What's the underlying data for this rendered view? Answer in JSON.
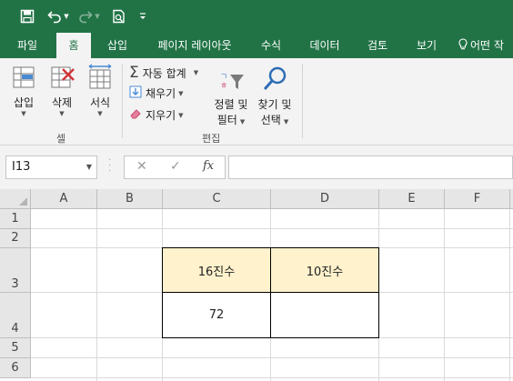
{
  "qat": {
    "save_icon": "save-icon",
    "undo_icon": "undo-icon",
    "redo_icon": "redo-icon",
    "print_preview_icon": "print-preview-icon",
    "customize_icon": "customize-qat-icon"
  },
  "tabs": [
    {
      "label": "파일"
    },
    {
      "label": "홈"
    },
    {
      "label": "삽입"
    },
    {
      "label": "페이지 레이아웃"
    },
    {
      "label": "수식"
    },
    {
      "label": "데이터"
    },
    {
      "label": "검토"
    },
    {
      "label": "보기"
    },
    {
      "label": "어떤 작"
    }
  ],
  "ribbon": {
    "cells_group": {
      "label": "셀",
      "insert": "삽입",
      "delete": "삭제",
      "format": "서식"
    },
    "editing_group": {
      "label": "편집",
      "autosum": "자동 합계",
      "fill": "채우기",
      "clear": "지우기",
      "sort_line1": "정렬 및",
      "sort_line2": "필터",
      "find_line1": "찾기 및",
      "find_line2": "선택"
    }
  },
  "formula_bar": {
    "name_box": "I13",
    "cancel": "✕",
    "enter": "✓",
    "fx": "fx",
    "formula": ""
  },
  "columns": [
    "A",
    "B",
    "C",
    "D",
    "E",
    "F"
  ],
  "rows": [
    "1",
    "2",
    "3",
    "4",
    "5",
    "6"
  ],
  "cells": {
    "C3": "16진수",
    "D3": "10진수",
    "C4": "72",
    "D4": ""
  },
  "colors": {
    "brand": "#217346",
    "header_fill": "#FFF2CC"
  }
}
